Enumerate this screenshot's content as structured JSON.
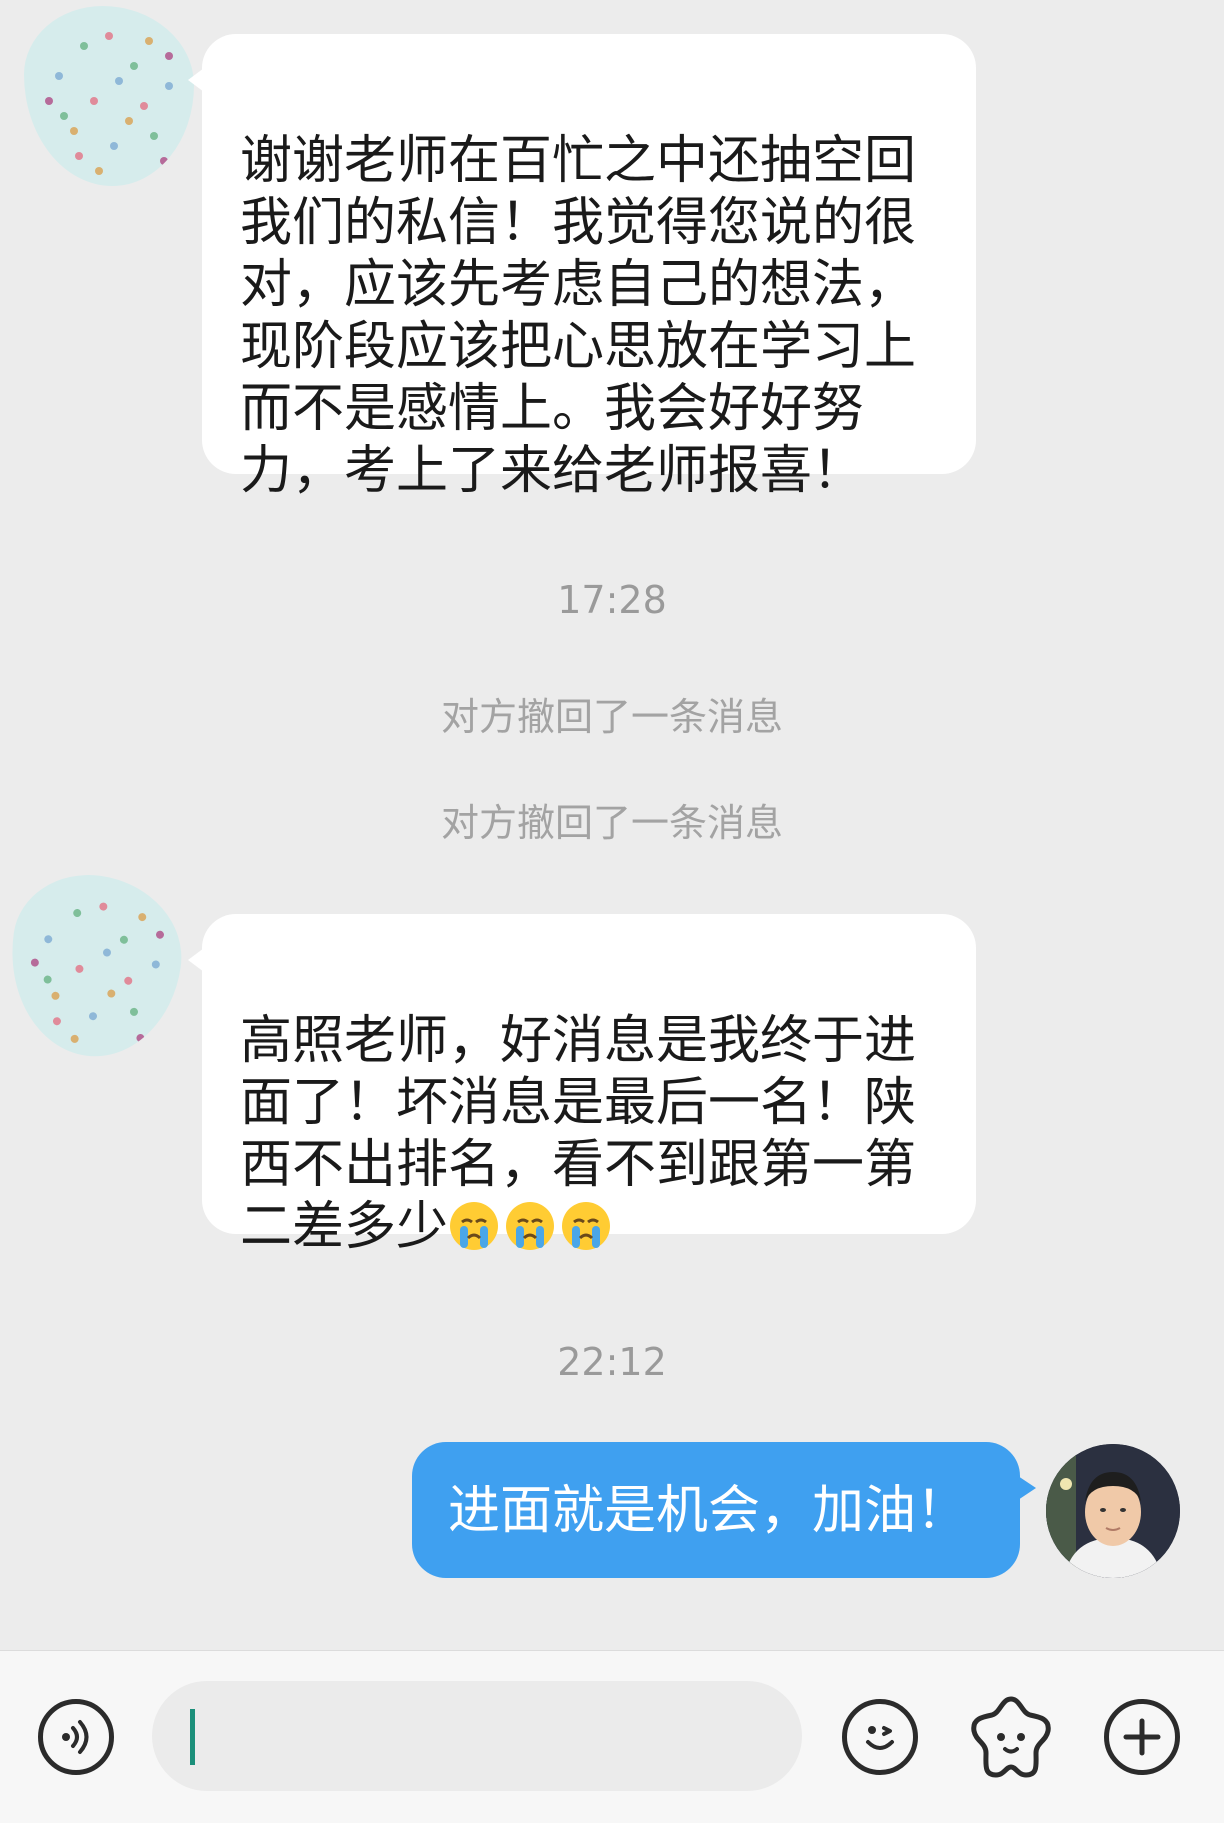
{
  "messages": [
    {
      "type": "incoming",
      "text": "谢谢老师在百忙之中还抽空回\n我们的私信！我觉得您说的很\n对，应该先考虑自己的想法，\n现阶段应该把心思放在学习上\n而不是感情上。我会好好努\n力，考上了来给老师报喜！"
    },
    {
      "type": "timestamp",
      "text": "17:28"
    },
    {
      "type": "system",
      "text": "对方撤回了一条消息"
    },
    {
      "type": "system",
      "text": "对方撤回了一条消息"
    },
    {
      "type": "incoming",
      "text": "高照老师，好消息是我终于进\n面了！坏消息是最后一名！陕\n西不出排名，看不到跟第一第\n二差多少",
      "emoji": [
        "crying-face",
        "crying-face",
        "crying-face"
      ]
    },
    {
      "type": "timestamp",
      "text": "22:12"
    },
    {
      "type": "outgoing",
      "text": "进面就是机会，加油！"
    }
  ],
  "input": {
    "value": "",
    "icons": [
      "voice-icon",
      "emoji-icon",
      "sticker-icon",
      "plus-icon"
    ]
  },
  "colors": {
    "background": "#ececec",
    "outgoing_bubble": "#3fa0f0",
    "incoming_bubble": "#ffffff",
    "caret": "#1b8f7a"
  }
}
